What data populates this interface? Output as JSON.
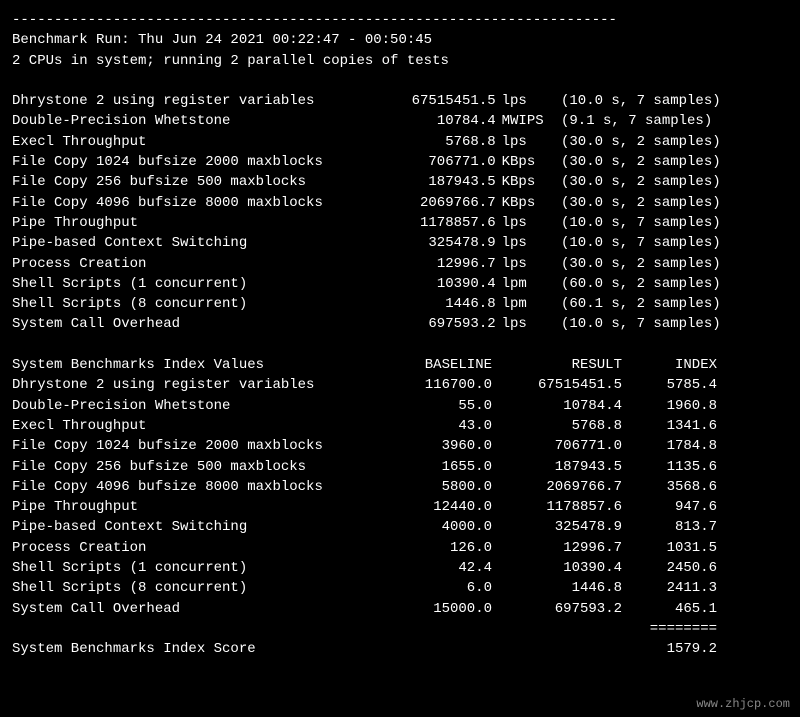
{
  "dashes_top": "------------------------------------------------------------------------",
  "run_line": "Benchmark Run: Thu Jun 24 2021 00:22:47 - 00:50:45",
  "cpu_line": "2 CPUs in system; running 2 parallel copies of tests",
  "raw_tests": [
    {
      "name": "Dhrystone 2 using register variables",
      "value": "67515451.5",
      "unit": "lps",
      "paren": "(10.0 s, 7 samples)"
    },
    {
      "name": "Double-Precision Whetstone",
      "value": "10784.4",
      "unit": "MWIPS",
      "paren": "(9.1 s, 7 samples)"
    },
    {
      "name": "Execl Throughput",
      "value": "5768.8",
      "unit": "lps",
      "paren": "(30.0 s, 2 samples)"
    },
    {
      "name": "File Copy 1024 bufsize 2000 maxblocks",
      "value": "706771.0",
      "unit": "KBps",
      "paren": "(30.0 s, 2 samples)"
    },
    {
      "name": "File Copy 256 bufsize 500 maxblocks",
      "value": "187943.5",
      "unit": "KBps",
      "paren": "(30.0 s, 2 samples)"
    },
    {
      "name": "File Copy 4096 bufsize 8000 maxblocks",
      "value": "2069766.7",
      "unit": "KBps",
      "paren": "(30.0 s, 2 samples)"
    },
    {
      "name": "Pipe Throughput",
      "value": "1178857.6",
      "unit": "lps",
      "paren": "(10.0 s, 7 samples)"
    },
    {
      "name": "Pipe-based Context Switching",
      "value": "325478.9",
      "unit": "lps",
      "paren": "(10.0 s, 7 samples)"
    },
    {
      "name": "Process Creation",
      "value": "12996.7",
      "unit": "lps",
      "paren": "(30.0 s, 2 samples)"
    },
    {
      "name": "Shell Scripts (1 concurrent)",
      "value": "10390.4",
      "unit": "lpm",
      "paren": "(60.0 s, 2 samples)"
    },
    {
      "name": "Shell Scripts (8 concurrent)",
      "value": "1446.8",
      "unit": "lpm",
      "paren": "(60.1 s, 2 samples)"
    },
    {
      "name": "System Call Overhead",
      "value": "697593.2",
      "unit": "lps",
      "paren": "(10.0 s, 7 samples)"
    }
  ],
  "index_header": {
    "name": "System Benchmarks Index Values",
    "baseline": "BASELINE",
    "result": "RESULT",
    "index": "INDEX"
  },
  "index_tests": [
    {
      "name": "Dhrystone 2 using register variables",
      "baseline": "116700.0",
      "result": "67515451.5",
      "index": "5785.4"
    },
    {
      "name": "Double-Precision Whetstone",
      "baseline": "55.0",
      "result": "10784.4",
      "index": "1960.8"
    },
    {
      "name": "Execl Throughput",
      "baseline": "43.0",
      "result": "5768.8",
      "index": "1341.6"
    },
    {
      "name": "File Copy 1024 bufsize 2000 maxblocks",
      "baseline": "3960.0",
      "result": "706771.0",
      "index": "1784.8"
    },
    {
      "name": "File Copy 256 bufsize 500 maxblocks",
      "baseline": "1655.0",
      "result": "187943.5",
      "index": "1135.6"
    },
    {
      "name": "File Copy 4096 bufsize 8000 maxblocks",
      "baseline": "5800.0",
      "result": "2069766.7",
      "index": "3568.6"
    },
    {
      "name": "Pipe Throughput",
      "baseline": "12440.0",
      "result": "1178857.6",
      "index": "947.6"
    },
    {
      "name": "Pipe-based Context Switching",
      "baseline": "4000.0",
      "result": "325478.9",
      "index": "813.7"
    },
    {
      "name": "Process Creation",
      "baseline": "126.0",
      "result": "12996.7",
      "index": "1031.5"
    },
    {
      "name": "Shell Scripts (1 concurrent)",
      "baseline": "42.4",
      "result": "10390.4",
      "index": "2450.6"
    },
    {
      "name": "Shell Scripts (8 concurrent)",
      "baseline": "6.0",
      "result": "1446.8",
      "index": "2411.3"
    },
    {
      "name": "System Call Overhead",
      "baseline": "15000.0",
      "result": "697593.2",
      "index": "465.1"
    }
  ],
  "score_rule": "========",
  "score_label": "System Benchmarks Index Score",
  "score_value": "1579.2",
  "watermark": "www.zhjcp.com"
}
